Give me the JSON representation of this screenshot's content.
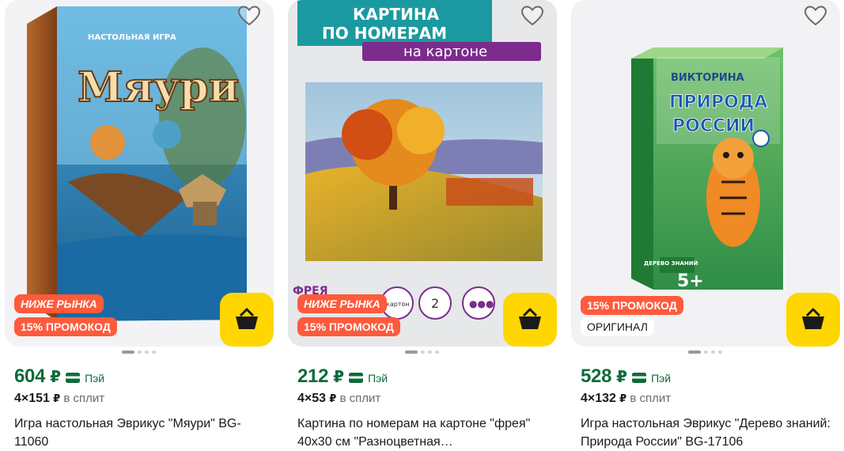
{
  "products": [
    {
      "badges": [
        {
          "kind": "market",
          "text": "НИЖЕ РЫНКА"
        },
        {
          "kind": "promo",
          "text": "15% ПРОМОКОД"
        }
      ],
      "dots": {
        "count": 4,
        "active": 0
      },
      "price": "604",
      "currency": "₽",
      "pay_label": "Пэй",
      "split_count": "4",
      "split_times": "×",
      "split_amount": "151",
      "split_label": "в сплит",
      "title": "Игра настольная Эврикус \"Мяури\" BG-11060",
      "image_text": {
        "top": "НАСТОЛЬНАЯ ИГРА",
        "name": "Мяури"
      }
    },
    {
      "badges": [
        {
          "kind": "market",
          "text": "НИЖЕ РЫНКА"
        },
        {
          "kind": "promo",
          "text": "15% ПРОМОКОД"
        }
      ],
      "dots": {
        "count": 4,
        "active": 0
      },
      "price": "212",
      "currency": "₽",
      "pay_label": "Пэй",
      "split_count": "4",
      "split_times": "×",
      "split_amount": "53",
      "split_label": "в сплит",
      "title": "Картина по номерам на картоне \"фрея\" 40x30 см \"Разноцветная…",
      "image_text": {
        "line1": "КАРТИНА",
        "line2": "ПО НОМЕРАМ",
        "line3": "на картоне",
        "brand": "ФРЕЯ",
        "c1": "картон",
        "c2": "2",
        "c3": "●●●"
      }
    },
    {
      "badges": [
        {
          "kind": "promo",
          "text": "15% ПРОМОКОД"
        },
        {
          "kind": "original",
          "text": "ОРИГИНАЛ"
        }
      ],
      "dots": {
        "count": 4,
        "active": 0
      },
      "price": "528",
      "currency": "₽",
      "pay_label": "Пэй",
      "split_count": "4",
      "split_times": "×",
      "split_amount": "132",
      "split_label": "в сплит",
      "title": "Игра настольная Эврикус \"Дерево знаний: Природа России\" BG-17106",
      "image_text": {
        "top": "ВИКТОРИНА",
        "l1": "ПРИРОДА",
        "l2": "РОССИИ",
        "age": "5+",
        "side": "ДЕРЕВО ЗНАНИЙ"
      }
    }
  ],
  "colors": {
    "promo_badge": "#ff5a3c",
    "cart_button": "#ffd600",
    "price_green": "#0d6b3a",
    "card_bg": "#f3f3f5"
  },
  "icons": {
    "favorite": "heart-outline-icon",
    "cart": "basket-icon",
    "pay": "card-pay-icon"
  }
}
